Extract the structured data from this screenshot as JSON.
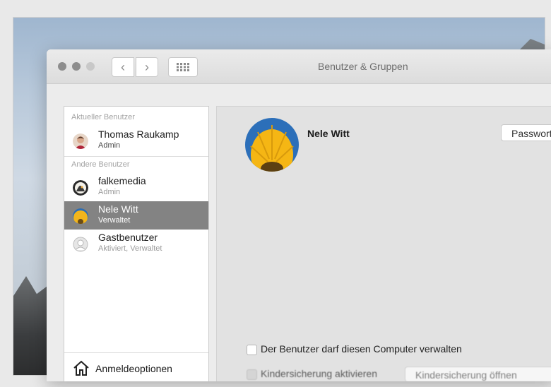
{
  "window": {
    "title": "Benutzer & Gruppen"
  },
  "toolbar": {
    "back_glyph": "‹",
    "forward_glyph": "›"
  },
  "sidebar": {
    "current_section": "Aktueller Benutzer",
    "current_user": {
      "name": "Thomas Raukamp",
      "role": "Admin"
    },
    "others_section": "Andere Benutzer",
    "other_users": [
      {
        "name": "falkemedia",
        "role": "Admin"
      },
      {
        "name": "Nele Witt",
        "role": "Verwaltet",
        "selected": true
      },
      {
        "name": "Gastbenutzer",
        "role": "Aktiviert, Verwaltet"
      }
    ],
    "login_options": "Anmeldeoptionen"
  },
  "main": {
    "user_name": "Nele Witt",
    "password_button": "Passwort",
    "allow_admin_label": "Der Benutzer darf diesen Computer verwalten",
    "parental_label": "Kindersicherung aktivieren",
    "parental_button": "Kindersicherung öffnen"
  },
  "colors": {
    "selection": "#838383",
    "window_bg": "#ececec"
  }
}
